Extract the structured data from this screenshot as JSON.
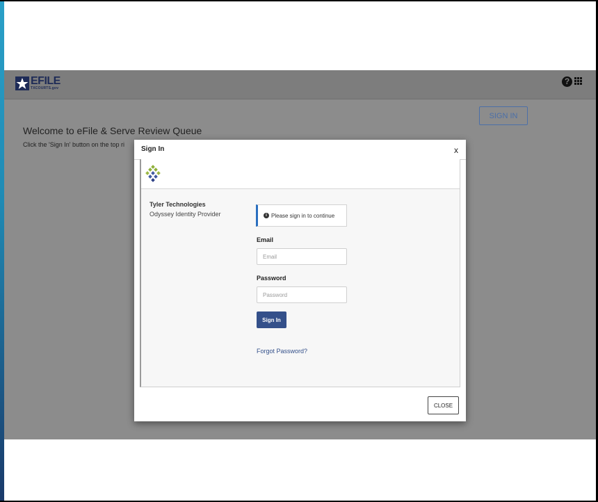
{
  "header": {
    "logo_text": "EFILE",
    "logo_subtext": "TXCOURTS.gov"
  },
  "page": {
    "sign_in_label": "SIGN IN",
    "welcome_title": "Welcome to eFile & Serve Review Queue",
    "welcome_subtitle": "Click the 'Sign In' button on the top ri"
  },
  "modal": {
    "title": "Sign In",
    "close_x": "x",
    "provider_name": "Tyler Technologies",
    "provider_sub": "Odyssey Identity Provider",
    "notice": "Please sign in to continue",
    "email_label": "Email",
    "email_placeholder": "Email",
    "email_value": "",
    "password_label": "Password",
    "password_placeholder": "Password",
    "password_value": "",
    "sign_in_button": "Sign In",
    "forgot_password": "Forgot Password?",
    "close_button": "CLOSE"
  },
  "colors": {
    "brand_blue": "#34508a",
    "notice_accent": "#2a6fbf",
    "backdrop": "#8c8c8c"
  },
  "icons": {
    "help": "question-circle-icon",
    "apps": "grid-icon",
    "info": "info-circle-icon",
    "logo": "tyler-logo-icon"
  }
}
